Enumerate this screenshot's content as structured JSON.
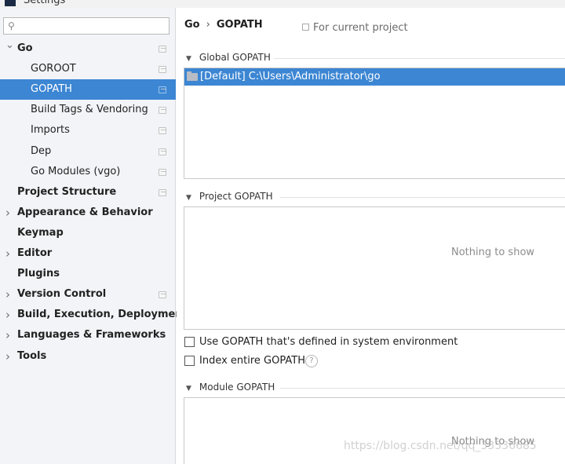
{
  "window": {
    "title": "Settings"
  },
  "search": {
    "placeholder": "",
    "value": ""
  },
  "sidebar": {
    "items": [
      {
        "label": "Go",
        "bold": true,
        "arrow": "v",
        "copy": true
      },
      {
        "label": "GOROOT",
        "bold": false,
        "arrow": "",
        "copy": true
      },
      {
        "label": "GOPATH",
        "bold": false,
        "arrow": "",
        "copy": true,
        "selected": true
      },
      {
        "label": "Build Tags & Vendoring",
        "bold": false,
        "arrow": "",
        "copy": true
      },
      {
        "label": "Imports",
        "bold": false,
        "arrow": "",
        "copy": true
      },
      {
        "label": "Dep",
        "bold": false,
        "arrow": "",
        "copy": true
      },
      {
        "label": "Go Modules (vgo)",
        "bold": false,
        "arrow": "",
        "copy": true
      },
      {
        "label": "Project Structure",
        "bold": true,
        "arrow": "",
        "copy": true
      },
      {
        "label": "Appearance & Behavior",
        "bold": true,
        "arrow": ">",
        "copy": false
      },
      {
        "label": "Keymap",
        "bold": true,
        "arrow": "",
        "copy": false
      },
      {
        "label": "Editor",
        "bold": true,
        "arrow": ">",
        "copy": false
      },
      {
        "label": "Plugins",
        "bold": true,
        "arrow": "",
        "copy": false
      },
      {
        "label": "Version Control",
        "bold": true,
        "arrow": ">",
        "copy": true
      },
      {
        "label": "Build, Execution, Deployment",
        "bold": true,
        "arrow": ">",
        "copy": false
      },
      {
        "label": "Languages & Frameworks",
        "bold": true,
        "arrow": ">",
        "copy": false
      },
      {
        "label": "Tools",
        "bold": true,
        "arrow": ">",
        "copy": false
      }
    ]
  },
  "breadcrumb": {
    "parent": "Go",
    "separator": "›",
    "current": "GOPATH"
  },
  "scope_label": "For current project",
  "global_gopath": {
    "title": "Global GOPATH",
    "entries": [
      "[Default] C:\\Users\\Administrator\\go"
    ]
  },
  "project_gopath": {
    "title": "Project GOPATH",
    "empty_text": "Nothing to show"
  },
  "options": {
    "use_system_gopath": {
      "label": "Use GOPATH that's defined in system environment",
      "checked": false
    },
    "index_entire_gopath": {
      "label": "Index entire GOPATH",
      "checked": false
    }
  },
  "module_gopath": {
    "title": "Module GOPATH",
    "empty_text": "Nothing to show"
  },
  "watermark": "https://blog.csdn.net/qq_33536685",
  "colors": {
    "selection": "#3c86d3",
    "sidebar_bg": "#f2f4f8"
  }
}
